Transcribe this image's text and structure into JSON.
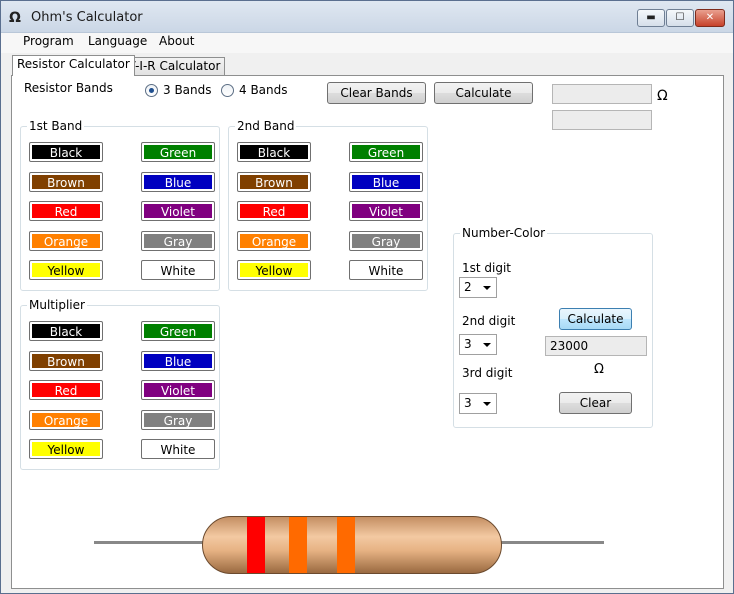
{
  "window": {
    "title": "Ohm's Calculator",
    "icon": "Ω"
  },
  "menu": [
    "Program",
    "Language",
    "About"
  ],
  "tabs": [
    "Resistor Calculator",
    "P-V-I-R Calculator"
  ],
  "resistor_bands": {
    "label": "Resistor Bands",
    "option_3": "3 Bands",
    "option_4": "4 Bands",
    "selected": "3 Bands"
  },
  "toolbar": {
    "clear_bands": "Clear Bands",
    "calculate": "Calculate"
  },
  "result": {
    "value_1": "",
    "value_2": "",
    "unit": "Ω"
  },
  "groups": {
    "band1": "1st Band",
    "band2": "2nd Band",
    "multiplier": "Multiplier",
    "number_color": "Number-Color"
  },
  "colors": [
    {
      "name": "Black",
      "bg": "#000000",
      "fg": "#ffffff"
    },
    {
      "name": "Green",
      "bg": "#008000",
      "fg": "#ffffff"
    },
    {
      "name": "Brown",
      "bg": "#804000",
      "fg": "#ffffff"
    },
    {
      "name": "Blue",
      "bg": "#0000c0",
      "fg": "#ffffff"
    },
    {
      "name": "Red",
      "bg": "#ff0000",
      "fg": "#ffffff"
    },
    {
      "name": "Violet",
      "bg": "#800080",
      "fg": "#ffffff"
    },
    {
      "name": "Orange",
      "bg": "#ff8000",
      "fg": "#ffffff"
    },
    {
      "name": "Gray",
      "bg": "#808080",
      "fg": "#ffffff"
    },
    {
      "name": "Yellow",
      "bg": "#ffff00",
      "fg": "#000000"
    },
    {
      "name": "White",
      "bg": "#ffffff",
      "fg": "#000000"
    }
  ],
  "number_color": {
    "digit1_label": "1st digit",
    "digit1_value": "2",
    "digit2_label": "2nd digit",
    "digit2_value": "3",
    "digit3_label": "3rd digit",
    "digit3_value": "3",
    "calculate": "Calculate",
    "result": "23000",
    "unit": "Ω",
    "clear": "Clear"
  },
  "resistor_graphic": {
    "bands": [
      "#ff0000",
      "#ff6a00",
      "#ff6a00"
    ],
    "wire_color": "#888888"
  }
}
